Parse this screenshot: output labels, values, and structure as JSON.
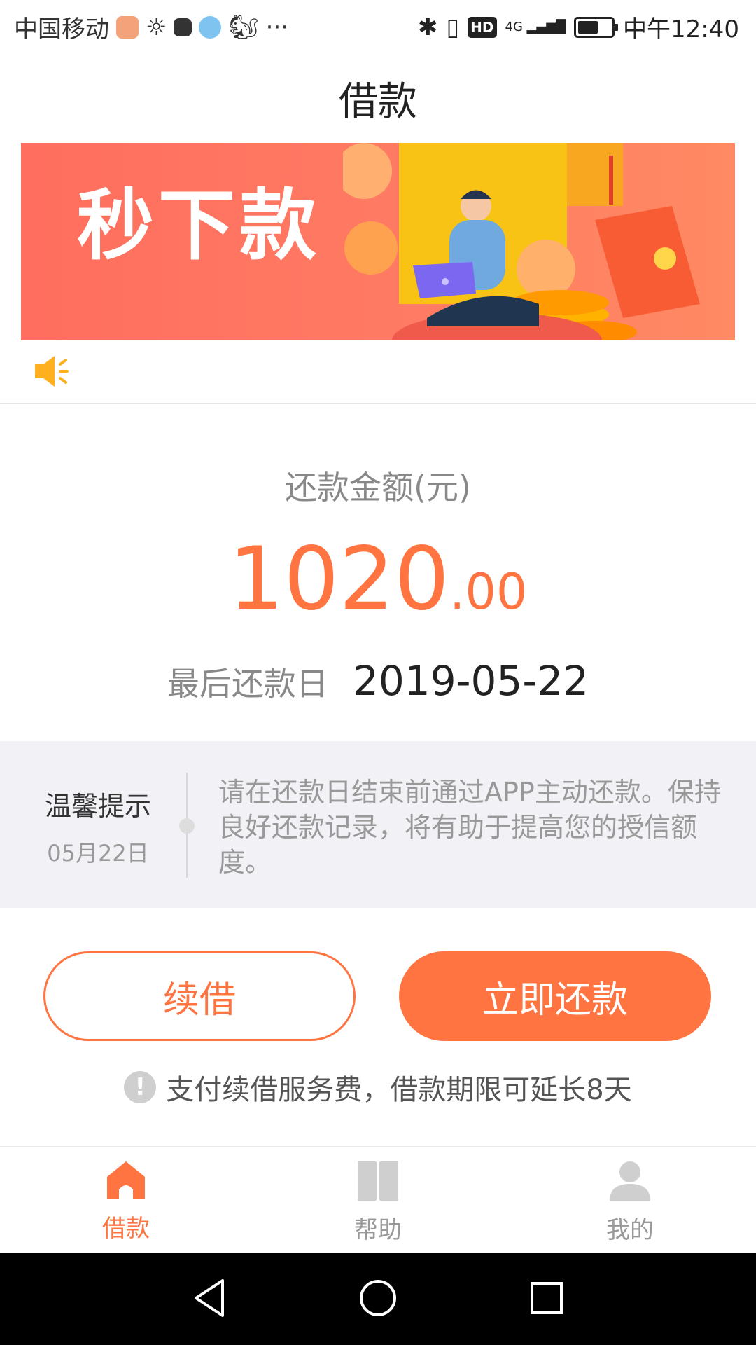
{
  "status_bar": {
    "carrier": "中国移动",
    "more": "···",
    "hd": "HD",
    "network": "4G",
    "time": "中午12:40"
  },
  "header": {
    "title": "借款"
  },
  "banner": {
    "headline": "秒下款"
  },
  "repayment": {
    "amount_label": "还款金额(元)",
    "amount_integer": "1020",
    "amount_decimal": ".00",
    "due_label": "最后还款日",
    "due_date": "2019-05-22"
  },
  "tip": {
    "title": "温馨提示",
    "date": "05月22日",
    "text": "请在还款日结束前通过APP主动还款。保持良好还款记录，将有助于提高您的授信额度。"
  },
  "actions": {
    "renew_label": "续借",
    "repay_label": "立即还款",
    "notice": "支付续借服务费，借款期限可延长8天",
    "notice_icon": "!"
  },
  "tabs": [
    {
      "label": "借款",
      "icon": "home-icon",
      "active": true
    },
    {
      "label": "帮助",
      "icon": "book-icon",
      "active": false
    },
    {
      "label": "我的",
      "icon": "user-icon",
      "active": false
    }
  ],
  "colors": {
    "accent": "#ff7440",
    "banner": "#ff6e5e",
    "tip_bg": "#f2f2f6"
  }
}
